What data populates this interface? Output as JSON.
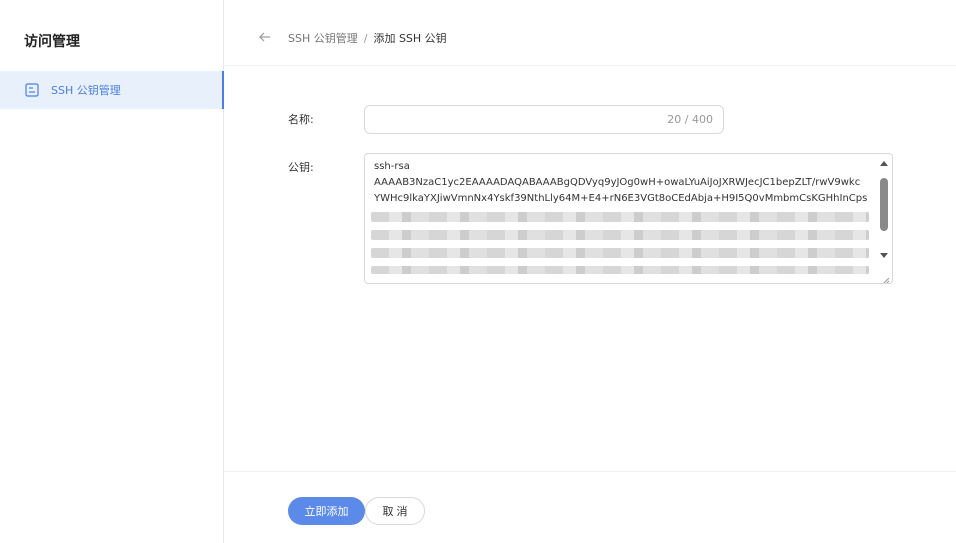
{
  "sidebar": {
    "title": "访问管理",
    "items": [
      {
        "label": "SSH 公钥管理",
        "icon": "document-list-icon",
        "active": true
      }
    ]
  },
  "header": {
    "back_icon": "arrow-left-icon",
    "breadcrumb": {
      "parent": "SSH 公钥管理",
      "separator": "/",
      "current": "添加 SSH 公钥"
    }
  },
  "form": {
    "name_label": "名称:",
    "name_value": "",
    "name_counter": "20 / 400",
    "key_label": "公钥:",
    "key_lines": [
      "ssh-rsa",
      "AAAAB3NzaC1yc2EAAAADAQABAAABgQDVyq9yJOg0wH+owaLYuAiJoJXRWJecJC1bepZLT/rwV9wkc",
      "YWHc9lkaYXJiwVmnNx4Yskf39NthLly64M+E4+rN6E3VGt8oCEdAbja+H9I5Q0vMmbmCsKGHhInCps"
    ]
  },
  "footer": {
    "submit_label": "立即添加",
    "cancel_label": "取 消"
  },
  "colors": {
    "accent": "#4a7fe0",
    "primary_button": "#5b8ae8",
    "active_bg": "#e8f0fc"
  }
}
